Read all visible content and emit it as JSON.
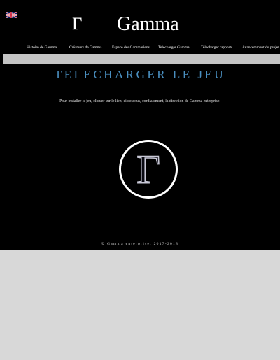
{
  "header": {
    "brand_symbol": "Γ",
    "brand_name": "Gamma",
    "language_icon": "uk-flag-icon"
  },
  "nav": {
    "items": [
      {
        "label": "Histoire de Gamma"
      },
      {
        "label": "Créateurs de Gamma"
      },
      {
        "label": "Espace des Gammariens"
      },
      {
        "label": "Telecharger Gamma"
      },
      {
        "label": "Telecharger rapports"
      },
      {
        "label": "Avancemment du projet"
      }
    ]
  },
  "main": {
    "title": "TELECHARGER LE JEU",
    "intro": "Pour installer le jeu, cliquer sur le lien, ci dessous, cordialement, la direction de Gamma enterprise.",
    "download_logo_symbol": "Γ",
    "download_icon": "gamma-logo-icon"
  },
  "footer": {
    "copyright": "© Gamma enterprise, 2017-2018"
  },
  "colors": {
    "background": "#000000",
    "title_accent": "#4a8fc0",
    "band": "#c4c4c4",
    "page_outside": "#d8d8d8"
  }
}
